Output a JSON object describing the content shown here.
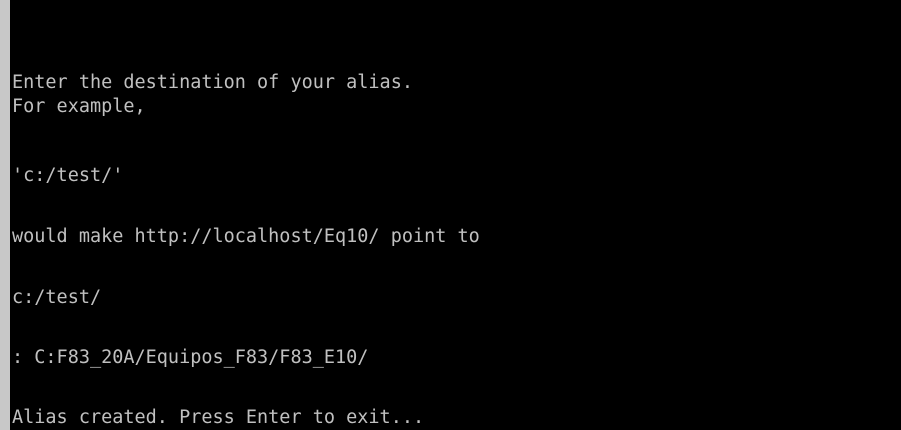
{
  "terminal": {
    "lines": [
      "Enter the destination of your alias.",
      "For example,",
      "'c:/test/'",
      "would make http://localhost/Eq10/ point to",
      "c:/test/",
      ": C:F83_20A/Equipos_F83/F83_E10/",
      "Alias created. Press Enter to exit..."
    ]
  },
  "colors": {
    "background": "#000000",
    "text": "#c0c0c0",
    "window_edge": "#c8c8c8"
  }
}
